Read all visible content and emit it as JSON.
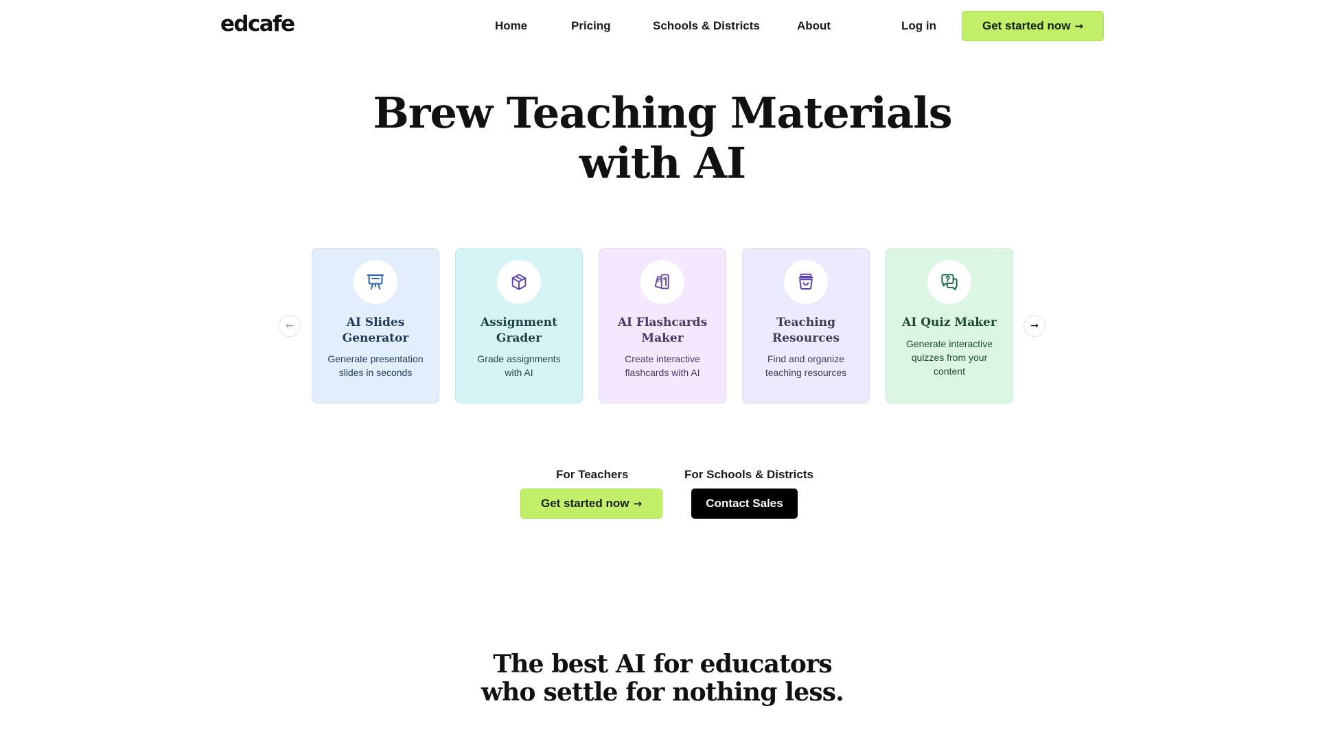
{
  "header": {
    "logo": "edcafe",
    "nav": {
      "home": "Home",
      "pricing": "Pricing",
      "schools": "Schools & Districts",
      "about": "About"
    },
    "login": "Log in",
    "cta": "Get started now",
    "cta_arrow": "→"
  },
  "hero": {
    "title_line1": "Brew Teaching Materials",
    "title_line2": "with AI"
  },
  "carousel": {
    "prev_icon": "arrow-left-icon",
    "next_icon": "arrow-right-icon",
    "prev_glyph": "←",
    "next_glyph": "→",
    "cards": [
      {
        "title_line1": "AI Slides",
        "title_line2": "Generator",
        "desc_line1": "Generate presentation",
        "desc_line2": "slides in seconds",
        "icon": "presentation-icon",
        "icon_color": "#2f5fb3"
      },
      {
        "title_line1": "Assignment",
        "title_line2": "Grader",
        "desc_line1": "Grade assignments",
        "desc_line2": "with AI",
        "icon": "cube-icon",
        "icon_color": "#5b3fb0"
      },
      {
        "title_line1": "AI Flashcards",
        "title_line2": "Maker",
        "desc_line1": "Create interactive",
        "desc_line2": "flashcards with AI",
        "icon": "flashcards-icon",
        "icon_color": "#6a55a8"
      },
      {
        "title_line1": "Teaching",
        "title_line2": "Resources",
        "desc_line1": "Find and organize",
        "desc_line2": "teaching resources",
        "icon": "basket-icon",
        "icon_color": "#5b3fb0"
      },
      {
        "title": "AI Quiz Maker",
        "desc_line1": "Generate interactive",
        "desc_line2": "quizzes from your",
        "desc_line3": "content",
        "icon": "quiz-chat-icon",
        "icon_color": "#1f6a46"
      }
    ]
  },
  "cta": {
    "teachers_label": "For Teachers",
    "teachers_button": "Get started now",
    "teachers_arrow": "→",
    "schools_label": "For Schools & Districts",
    "schools_button": "Contact Sales"
  },
  "tagline": {
    "line1": "The best AI for educators",
    "line2": "who settle for nothing less."
  },
  "colors": {
    "accent_lime": "#c2ef6a",
    "dark_button": "#000000"
  }
}
